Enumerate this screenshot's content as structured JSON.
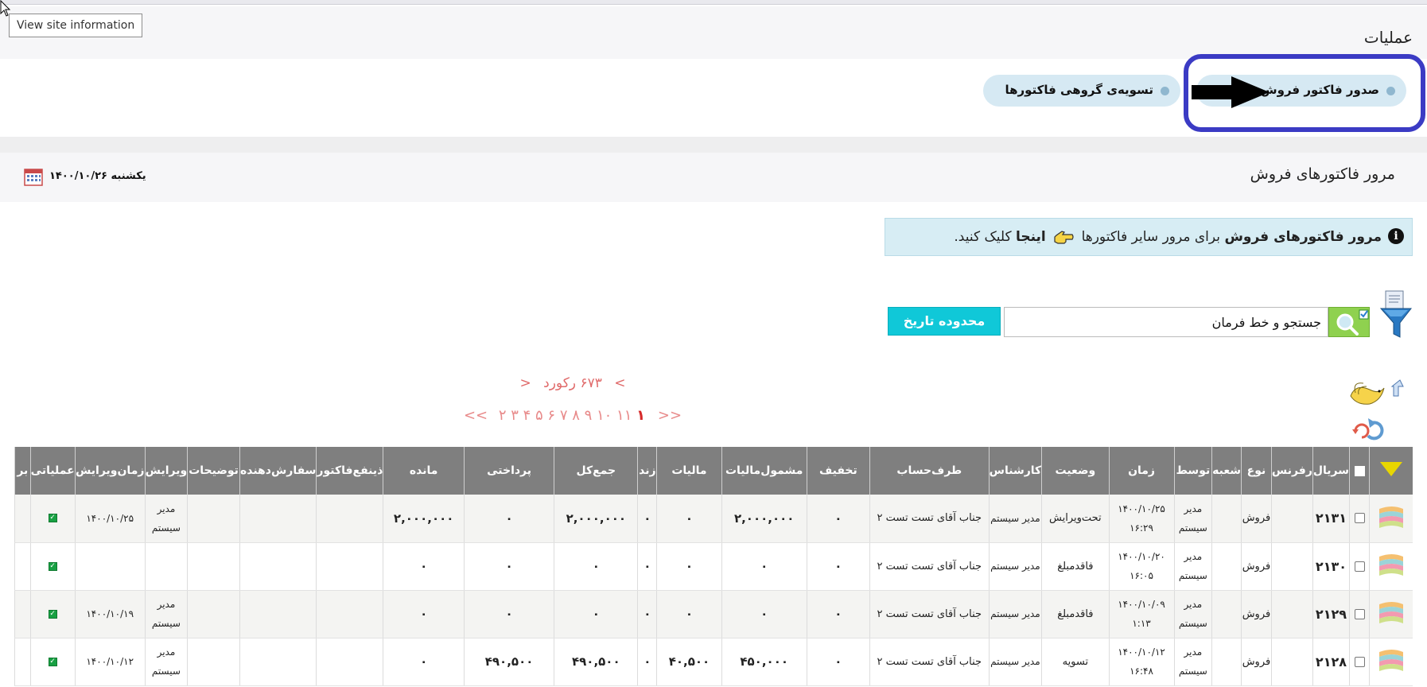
{
  "tooltip": "View site information",
  "ops_title": "عملیات",
  "tabs": {
    "sale_invoice": "صدور فاکتور فروش",
    "group_settlement": "تسویه‌ی گروهی فاکتورها"
  },
  "browse": {
    "title": "مرور فاکتورهای فروش",
    "date": "یکشنبه ۱۴۰۰/۱۰/۲۶"
  },
  "info": {
    "bold1": "مرور فاکتورهای فروش",
    "mid": "برای مرور سایر فاکتورها",
    "link": "اینجا",
    "end": "کلیک کنید."
  },
  "search": {
    "value": "جستجو و خط فرمان",
    "date_range_button": "محدوده تاریخ"
  },
  "records_text": "۶۷۳ رکورد",
  "records_prev": "<",
  "records_next": ">",
  "pager": {
    "first": ">>",
    "last": "<<",
    "current": "۱",
    "pages": "۲ ۳ ۴ ۵ ۶ ۷ ۸ ۹ ۱۰ ۱۱"
  },
  "table": {
    "headers": {
      "serial": "سریال",
      "reference": "رفرنس",
      "type": "نوع",
      "branch": "شعبه",
      "by": "توسط",
      "time": "زمان",
      "status": "وضعیت",
      "expert": "کارشناس",
      "party": "طرف‌حساب",
      "discount": "تخفیف",
      "taxable": "مشمول‌مالیات",
      "tax": "مالیات",
      "zand": "زند",
      "total": "جمع‌کل",
      "paid": "پرداختی",
      "remaining": "مانده",
      "beneficiary": "ذینفع‌فاکتور",
      "orderer": "سفارش‌دهنده",
      "description": "توضیحات",
      "editor": "ویرایش",
      "edit_time": "زمان‌ویرایش",
      "operational": "عملیاتی",
      "more": "بر"
    },
    "rows": [
      {
        "serial": "۲۱۳۱",
        "reference": "",
        "type": "فروش",
        "branch": "",
        "by": "مدیر سیستم",
        "time": "۱۴۰۰/۱۰/۲۵ ۱۶:۲۹",
        "status": "تحت‌ویرایش",
        "expert": "مدیر سیستم",
        "party": "جناب آقای تست تست ۲",
        "discount": "۰",
        "taxable": "۲,۰۰۰,۰۰۰",
        "tax": "۰",
        "zand": "۰",
        "total": "۲,۰۰۰,۰۰۰",
        "paid": "۰",
        "remaining": "۲,۰۰۰,۰۰۰",
        "beneficiary": "",
        "orderer": "",
        "description": "",
        "editor": "مدیر سیستم",
        "edit_time": "۱۴۰۰/۱۰/۲۵"
      },
      {
        "serial": "۲۱۳۰",
        "reference": "",
        "type": "فروش",
        "branch": "",
        "by": "مدیر سیستم",
        "time": "۱۴۰۰/۱۰/۲۰ ۱۶:۰۵",
        "status": "فاقدمبلغ",
        "expert": "مدیر سیستم",
        "party": "جناب آقای تست تست ۲",
        "discount": "۰",
        "taxable": "۰",
        "tax": "۰",
        "zand": "۰",
        "total": "۰",
        "paid": "۰",
        "remaining": "۰",
        "beneficiary": "",
        "orderer": "",
        "description": "",
        "editor": "",
        "edit_time": ""
      },
      {
        "serial": "۲۱۲۹",
        "reference": "",
        "type": "فروش",
        "branch": "",
        "by": "مدیر سیستم",
        "time": "۱۴۰۰/۱۰/۰۹ ۱:۱۳",
        "status": "فاقدمبلغ",
        "expert": "مدیر سیستم",
        "party": "جناب آقای تست تست ۲",
        "discount": "۰",
        "taxable": "۰",
        "tax": "۰",
        "zand": "۰",
        "total": "۰",
        "paid": "۰",
        "remaining": "۰",
        "beneficiary": "",
        "orderer": "",
        "description": "",
        "editor": "مدیر سیستم",
        "edit_time": "۱۴۰۰/۱۰/۱۹"
      },
      {
        "serial": "۲۱۲۸",
        "reference": "",
        "type": "فروش",
        "branch": "",
        "by": "مدیر سیستم",
        "time": "۱۴۰۰/۱۰/۱۲ ۱۶:۴۸",
        "status": "تسویه",
        "expert": "مدیر سیستم",
        "party": "جناب آقای تست تست ۲",
        "discount": "۰",
        "taxable": "۴۵۰,۰۰۰",
        "tax": "۴۰,۵۰۰",
        "zand": "۰",
        "total": "۴۹۰,۵۰۰",
        "paid": "۴۹۰,۵۰۰",
        "remaining": "۰",
        "beneficiary": "",
        "orderer": "",
        "description": "",
        "editor": "مدیر سیستم",
        "edit_time": "۱۴۰۰/۱۰/۱۲"
      }
    ]
  }
}
